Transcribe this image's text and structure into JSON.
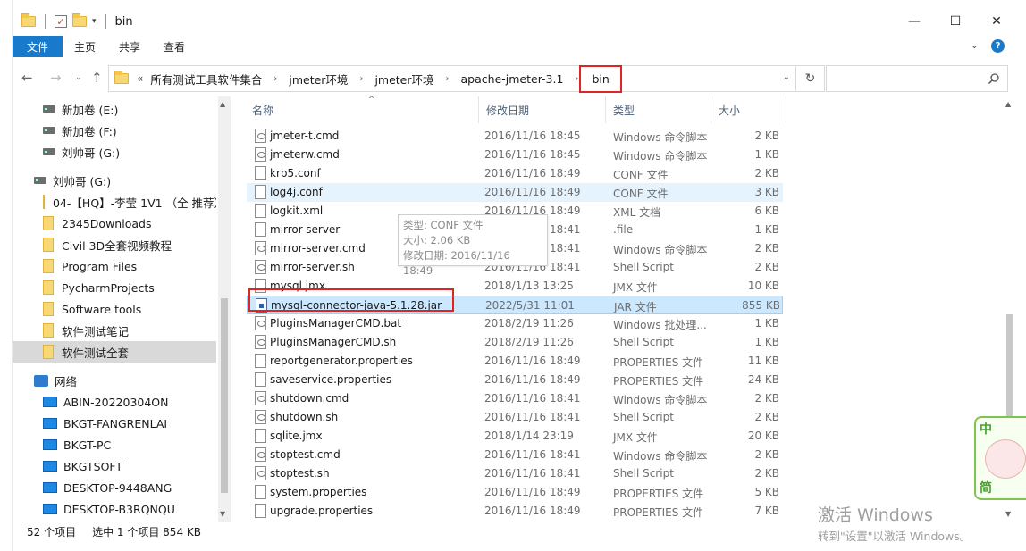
{
  "window": {
    "title": "bin",
    "controls": {
      "minimize": "—",
      "maximize": "☐",
      "close": "✕"
    }
  },
  "ribbon": {
    "tabs": [
      "文件",
      "主页",
      "共享",
      "查看"
    ],
    "active_tab": "文件"
  },
  "address": {
    "lead": "«",
    "crumbs": [
      "所有测试工具软件集合",
      "jmeter环境",
      "jmeter环境",
      "apache-jmeter-3.1",
      "bin"
    ],
    "separator": "›",
    "refresh_icon": "refresh-icon",
    "search_placeholder": ""
  },
  "navpane": {
    "items": [
      {
        "label": "新加卷 (E:)",
        "icon": "drive-icon"
      },
      {
        "label": "新加卷 (F:)",
        "icon": "drive-icon"
      },
      {
        "label": "刘帅哥 (G:)",
        "icon": "drive-icon"
      },
      {
        "label": "刘帅哥 (G:)",
        "icon": "drive-icon"
      },
      {
        "label": "04-【HQ】-李莹 1V1 （全 推荐）",
        "icon": "folder-icon"
      },
      {
        "label": "2345Downloads",
        "icon": "folder-icon"
      },
      {
        "label": "Civil 3D全套视频教程",
        "icon": "folder-icon"
      },
      {
        "label": "Program Files",
        "icon": "folder-icon"
      },
      {
        "label": "PycharmProjects",
        "icon": "folder-icon"
      },
      {
        "label": "Software tools",
        "icon": "folder-icon"
      },
      {
        "label": "软件测试笔记",
        "icon": "folder-icon"
      },
      {
        "label": "软件测试全套",
        "icon": "folder-icon"
      },
      {
        "label": "网络",
        "icon": "network-icon"
      },
      {
        "label": "ABIN-20220304ON",
        "icon": "computer-icon"
      },
      {
        "label": "BKGT-FANGRENLAI",
        "icon": "computer-icon"
      },
      {
        "label": "BKGT-PC",
        "icon": "computer-icon"
      },
      {
        "label": "BKGTSOFT",
        "icon": "computer-icon"
      },
      {
        "label": "DESKTOP-9448ANG",
        "icon": "computer-icon"
      },
      {
        "label": "DESKTOP-B3RQNQU",
        "icon": "computer-icon"
      }
    ]
  },
  "columns": {
    "name": "名称",
    "date": "修改日期",
    "type": "类型",
    "size": "大小"
  },
  "files": [
    {
      "name": "jmeter-t.cmd",
      "date": "2016/11/16 18:45",
      "type": "Windows 命令脚本",
      "size": "2 KB",
      "icon": "cmd"
    },
    {
      "name": "jmeterw.cmd",
      "date": "2016/11/16 18:45",
      "type": "Windows 命令脚本",
      "size": "1 KB",
      "icon": "cmd"
    },
    {
      "name": "krb5.conf",
      "date": "2016/11/16 18:49",
      "type": "CONF 文件",
      "size": "2 KB",
      "icon": "file"
    },
    {
      "name": "log4j.conf",
      "date": "2016/11/16 18:49",
      "type": "CONF 文件",
      "size": "3 KB",
      "icon": "file"
    },
    {
      "name": "logkit.xml",
      "date": "2016/11/16 18:49",
      "type": "XML 文档",
      "size": "6 KB",
      "icon": "file"
    },
    {
      "name": "mirror-server",
      "date": "2016/11/16 18:41",
      "type": ".file",
      "size": "1 KB",
      "icon": "file"
    },
    {
      "name": "mirror-server.cmd",
      "date": "2016/11/16 18:41",
      "type": "Windows 命令脚本",
      "size": "2 KB",
      "icon": "cmd"
    },
    {
      "name": "mirror-server.sh",
      "date": "2016/11/16 18:41",
      "type": "Shell Script",
      "size": "2 KB",
      "icon": "cmd"
    },
    {
      "name": "mysql.jmx",
      "date": "2018/1/13 13:25",
      "type": "JMX 文件",
      "size": "10 KB",
      "icon": "file"
    },
    {
      "name": "mysql-connector-java-5.1.28.jar",
      "date": "2022/5/31 11:01",
      "type": "JAR 文件",
      "size": "855 KB",
      "icon": "jar"
    },
    {
      "name": "PluginsManagerCMD.bat",
      "date": "2018/2/19 11:26",
      "type": "Windows 批处理...",
      "size": "1 KB",
      "icon": "cmd"
    },
    {
      "name": "PluginsManagerCMD.sh",
      "date": "2018/2/19 11:26",
      "type": "Shell Script",
      "size": "1 KB",
      "icon": "cmd"
    },
    {
      "name": "reportgenerator.properties",
      "date": "2016/11/16 18:49",
      "type": "PROPERTIES 文件",
      "size": "11 KB",
      "icon": "file"
    },
    {
      "name": "saveservice.properties",
      "date": "2016/11/16 18:49",
      "type": "PROPERTIES 文件",
      "size": "24 KB",
      "icon": "file"
    },
    {
      "name": "shutdown.cmd",
      "date": "2016/11/16 18:41",
      "type": "Windows 命令脚本",
      "size": "2 KB",
      "icon": "cmd"
    },
    {
      "name": "shutdown.sh",
      "date": "2016/11/16 18:41",
      "type": "Shell Script",
      "size": "2 KB",
      "icon": "cmd"
    },
    {
      "name": "sqlite.jmx",
      "date": "2018/1/14 23:19",
      "type": "JMX 文件",
      "size": "20 KB",
      "icon": "file"
    },
    {
      "name": "stoptest.cmd",
      "date": "2016/11/16 18:41",
      "type": "Windows 命令脚本",
      "size": "2 KB",
      "icon": "cmd"
    },
    {
      "name": "stoptest.sh",
      "date": "2016/11/16 18:41",
      "type": "Shell Script",
      "size": "2 KB",
      "icon": "cmd"
    },
    {
      "name": "system.properties",
      "date": "2016/11/16 18:49",
      "type": "PROPERTIES 文件",
      "size": "5 KB",
      "icon": "file"
    },
    {
      "name": "upgrade.properties",
      "date": "2016/11/16 18:49",
      "type": "PROPERTIES 文件",
      "size": "7 KB",
      "icon": "file"
    }
  ],
  "tooltip": {
    "line1": "类型: CONF 文件",
    "line2": "大小: 2.06 KB",
    "line3": "修改日期: 2016/11/16 18:49"
  },
  "status": {
    "count": "52 个项目",
    "selected": "选中 1 个项目  854 KB"
  },
  "watermark": {
    "line1": "激活 Windows",
    "line2": "转到\"设置\"以激活 Windows。"
  },
  "ime": {
    "top": "中",
    "bottom": "简"
  }
}
